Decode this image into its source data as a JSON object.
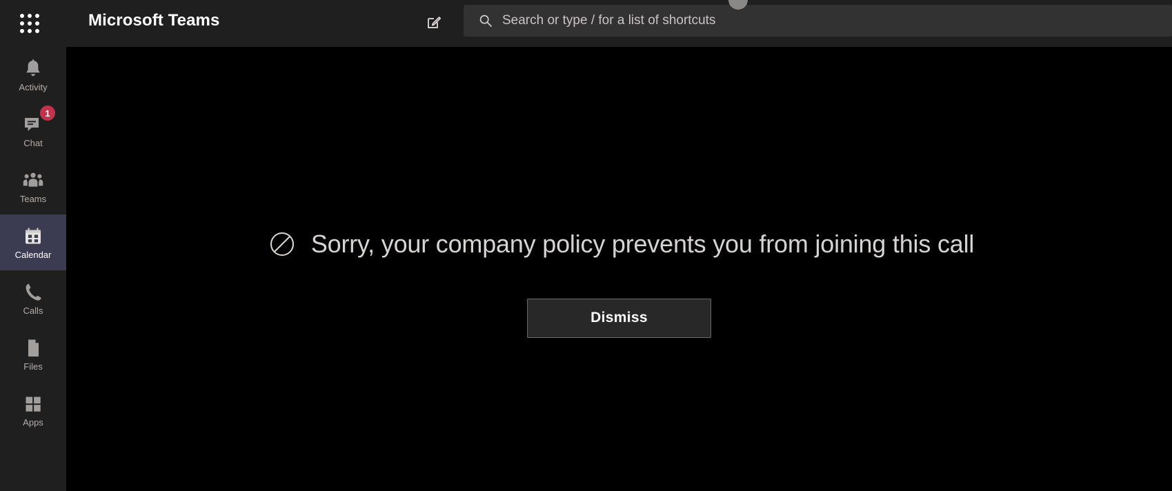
{
  "header": {
    "app_title": "Microsoft Teams",
    "waffle_icon": "app-launcher-grid-icon",
    "compose_icon": "compose-new-chat-icon",
    "search_icon": "search-icon",
    "search_value": "",
    "search_placeholder": "Search or type / for a list of shortcuts",
    "avatar_icon": "user-avatar"
  },
  "sidebar": {
    "items": [
      {
        "label": "Activity",
        "icon": "bell-icon",
        "selected": false,
        "badge": ""
      },
      {
        "label": "Chat",
        "icon": "chat-bubble-icon",
        "selected": false,
        "badge": "1"
      },
      {
        "label": "Teams",
        "icon": "people-group-icon",
        "selected": false,
        "badge": ""
      },
      {
        "label": "Calendar",
        "icon": "calendar-icon",
        "selected": true,
        "badge": ""
      },
      {
        "label": "Calls",
        "icon": "phone-icon",
        "selected": false,
        "badge": ""
      },
      {
        "label": "Files",
        "icon": "file-document-icon",
        "selected": false,
        "badge": ""
      },
      {
        "label": "Apps",
        "icon": "apps-grid-icon",
        "selected": false,
        "badge": ""
      }
    ],
    "selected_highlight_color": "#3b3b52"
  },
  "main": {
    "status_icon": "prohibited-circle-slash-icon",
    "message": "Sorry, your company policy prevents you from joining this call",
    "dismiss_label": "Dismiss",
    "background_color": "#000000",
    "text_color": "#d6d4d2"
  }
}
